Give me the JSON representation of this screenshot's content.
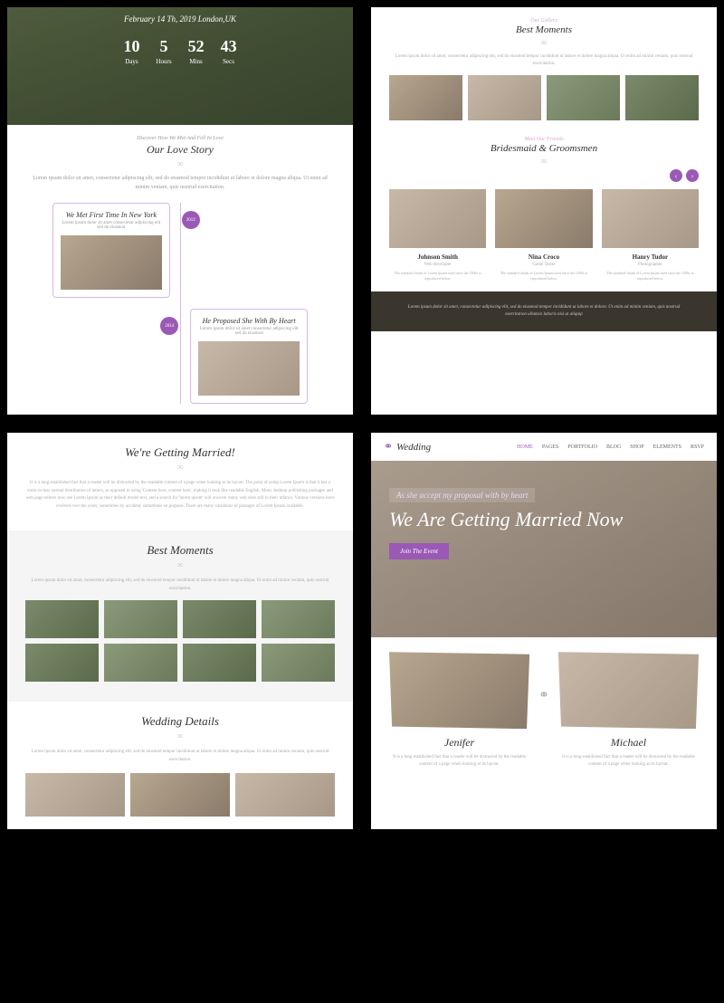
{
  "c1": {
    "date": "February 14 Th, 2019 London,UK",
    "countdown": [
      {
        "n": "10",
        "l": "Days"
      },
      {
        "n": "5",
        "l": "Hours"
      },
      {
        "n": "52",
        "l": "Mins"
      },
      {
        "n": "43",
        "l": "Secs"
      }
    ],
    "sub": "Discover How We Met And Fell In Love",
    "title": "Our Love Story",
    "desc": "Lorem ipsum dolor sit amet, consectetur adipiscing elit, sed do eiusmod tempor incididunt ut labore et dolore magna aliqua. Ut enim ad minim veniam, quis nostrud exercitation.",
    "timeline": [
      {
        "year": "2012",
        "title": "We Met First Time In New York",
        "desc": "Lorem ipsum dolor sit amet consectetur adipiscing elit sed do eiusmod"
      },
      {
        "year": "2014",
        "title": "He Proposed She With By Heart",
        "desc": "Lorem ipsum dolor sit amet consectetur adipiscing elit sed do eiusmod"
      }
    ]
  },
  "c2": {
    "sub1": "Our Gallery",
    "title1": "Best Moments",
    "desc1": "Lorem ipsum dolor sit amet, consectetur adipiscing elit, sed do eiusmod tempor incididunt ut labore et dolore magna aliqua. Ut enim ad minim veniam, quis nostrud exercitation.",
    "sub2": "Meet Our Friends",
    "title2": "Bridesmaid & Groomsmen",
    "team": [
      {
        "name": "Johnson Smith",
        "role": "Web developer",
        "desc": "The standard chunk of Lorem Ipsum used since the 1500s is reproduced below."
      },
      {
        "name": "Nina Croco",
        "role": "Game Tester",
        "desc": "The standard chunk of Lorem Ipsum used since the 1500s is reproduced below."
      },
      {
        "name": "Hanry Tudor",
        "role": "Photographer",
        "desc": "The standard chunk of Lorem Ipsum used since the 1500s is reproduced below."
      }
    ],
    "foot": "Lorem ipsum dolor sit amet, consectetur adipiscing elit, sed do eiusmod tempor incididunt ut labore et dolore. Ut enim ad minim veniam, quis nostrud exercitation ullamco laboris nisi ut aliquip"
  },
  "c3": {
    "title1": "We're Getting Married!",
    "desc1": "It is a long established fact that a reader will be distracted by the readable content of a page when looking at its layout. The point of using Lorem Ipsum is that it has a more-or-less normal distribution of letters, as opposed to using 'Content here, content here', making it look like readable English. Many desktop publishing packages and web page editors now use Lorem Ipsum as their default model text, and a search for 'lorem ipsum' will uncover many web sites still in their infancy. Various versions have evolved over the years, sometimes by accident, sometimes on purpose. There are many variations of passages of Lorem Ipsum available.",
    "title2": "Best Moments",
    "desc2": "Lorem ipsum dolor sit amet, consectetur adipiscing elit, sed do eiusmod tempor incididunt ut labore et dolore magna aliqua. Ut enim ad minim veniam, quis nostrud exercitation.",
    "title3": "Wedding Details",
    "desc3": "Lorem ipsum dolor sit amet, consectetur adipiscing elit, sed do eiusmod tempor incididunt ut labore et dolore magna aliqua. Ut enim ad minim veniam, quis nostrud exercitation."
  },
  "c4": {
    "brand": "Wedding",
    "menu": [
      "HOME",
      "PAGES",
      "PORTFOLIO",
      "BLOG",
      "SHOP",
      "ELEMENTS",
      "RSVP"
    ],
    "sub": "As she accept my proposal with by heart",
    "title": "We Are Getting Married Now",
    "btn": "Join The Event",
    "people": [
      {
        "name": "Jenifer",
        "desc": "It is a long established fact that a reader will be distracted by the readable content of a page when looking at its layout."
      },
      {
        "name": "Michael",
        "desc": "It is a long established fact that a reader will be distracted by the readable content of a page when looking at its layout."
      }
    ]
  }
}
